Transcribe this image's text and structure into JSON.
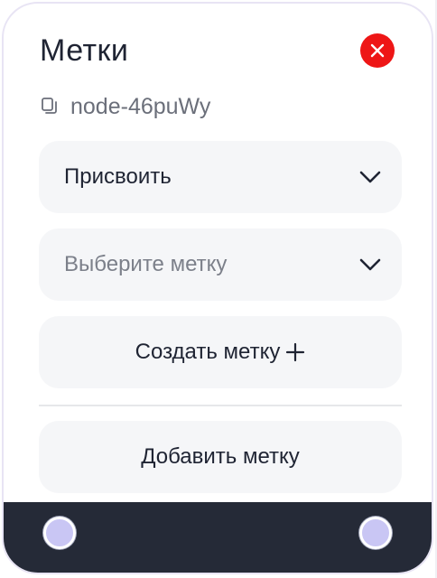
{
  "panel": {
    "title": "Метки",
    "node_id": "node-46puWy"
  },
  "assign_select": {
    "value": "Присвоить"
  },
  "tag_select": {
    "placeholder": "Выберите метку"
  },
  "create_button": {
    "label": "Создать метку",
    "icon": "plus-icon"
  },
  "add_button": {
    "label": "Добавить метку"
  },
  "colors": {
    "close_button": "#ee1616",
    "footer": "#252a37",
    "handle_fill": "#c9c6f4",
    "field_background": "#f5f6f8"
  },
  "icons": {
    "close": "close-icon",
    "copy": "copy-icon",
    "chevron": "chevron-down-icon",
    "handle": "connection-handle"
  }
}
